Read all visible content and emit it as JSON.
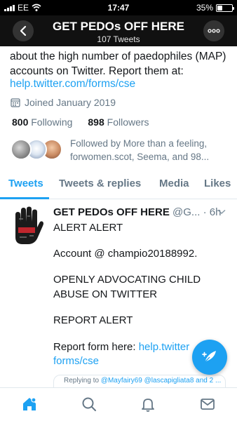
{
  "status_bar": {
    "carrier": "EE",
    "time": "17:47",
    "battery_percent": "35%",
    "battery_level": 0.35
  },
  "header": {
    "title": "GET PEDOs OFF HERE",
    "tweet_count": "107 Tweets",
    "back_icon": "chevron-left-icon",
    "more_icon": "more-icon"
  },
  "profile": {
    "bio": "about the high number of paedophiles (MAP) accounts on Twitter. Report them at:",
    "bio_link": "help.twitter.com/forms/cse",
    "joined": "Joined January 2019",
    "following_count": "800",
    "following_label": "Following",
    "followers_count": "898",
    "followers_label": "Followers",
    "followed_by_line1": "Followed by More than a feeling,",
    "followed_by_line2": "forwomen.scot, Seema, and 98..."
  },
  "tabs": [
    {
      "label": "Tweets",
      "active": true
    },
    {
      "label": "Tweets & replies",
      "active": false
    },
    {
      "label": "Media",
      "active": false
    },
    {
      "label": "Likes",
      "active": false
    }
  ],
  "tweet": {
    "name": "GET PEDOs OFF HERE",
    "handle": "@G...",
    "separator": "·",
    "time": "6h",
    "lines": {
      "l1": "ALERT ALERT",
      "l2": "Account @ champio20188992.",
      "l3": "OPENLY ADVOCATING CHILD",
      "l4": "ABUSE ON TWITTER",
      "l5": "REPORT ALERT",
      "l6_text": "Report form here: ",
      "l6_link": "help.twitter",
      "l7_link": "forms/cse"
    },
    "quote_text": "Replying to ",
    "quote_link": "@Mayfairy69 @lascapigliata8 and 2 ..."
  },
  "colors": {
    "accent": "#1da1f2",
    "text_primary": "#14171a",
    "text_secondary": "#657786",
    "header_bg": "#111111"
  },
  "bottom_nav": [
    {
      "icon": "home-icon",
      "active": true
    },
    {
      "icon": "search-icon",
      "active": false
    },
    {
      "icon": "bell-icon",
      "active": false
    },
    {
      "icon": "mail-icon",
      "active": false
    }
  ]
}
